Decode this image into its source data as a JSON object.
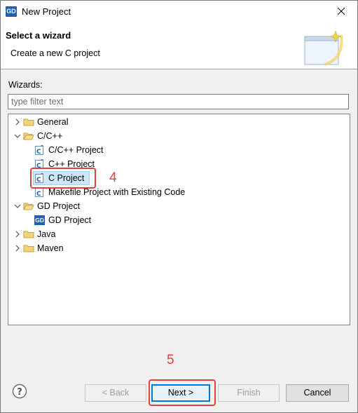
{
  "window": {
    "title": "New Project",
    "app_icon_text": "GD"
  },
  "header": {
    "title": "Select a wizard",
    "description": "Create a new C project"
  },
  "wizards": {
    "label": "Wizards:",
    "filter_placeholder": "type filter text",
    "tree": [
      {
        "label": "General",
        "expanded": false,
        "icon": "folder-icon"
      },
      {
        "label": "C/C++",
        "expanded": true,
        "icon": "folder-icon"
      },
      {
        "label": "C/C++ Project",
        "icon": "c-project-icon"
      },
      {
        "label": "C++ Project",
        "icon": "c-project-icon"
      },
      {
        "label": "C Project",
        "icon": "c-project-icon",
        "selected": true
      },
      {
        "label": "Makefile Project with Existing Code",
        "icon": "c-project-icon"
      },
      {
        "label": "GD Project",
        "expanded": true,
        "icon": "folder-icon"
      },
      {
        "label": "GD Project",
        "icon": "gd-icon",
        "icon_text": "GD"
      },
      {
        "label": "Java",
        "expanded": false,
        "icon": "folder-icon"
      },
      {
        "label": "Maven",
        "expanded": false,
        "icon": "folder-icon"
      }
    ]
  },
  "annotations": {
    "step4": "4",
    "step5": "5"
  },
  "buttons": {
    "back": "< Back",
    "next": "Next >",
    "finish": "Finish",
    "cancel": "Cancel"
  },
  "colors": {
    "annotation": "#e0413a",
    "selection": "#cce8ff",
    "default_button_border": "#0078d7",
    "gd_blue": "#1f5fb7",
    "folder": "#e8c05a"
  }
}
